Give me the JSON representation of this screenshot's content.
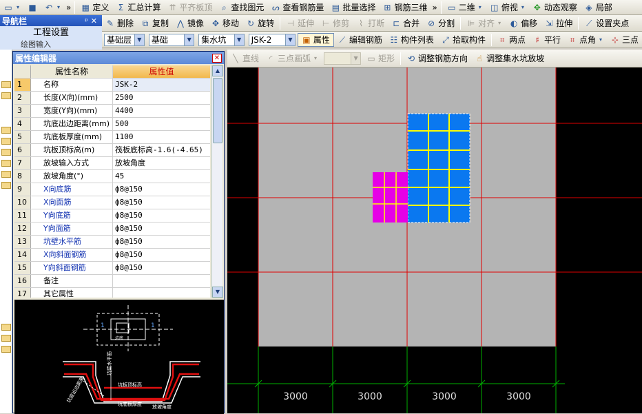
{
  "toolbar1": {
    "define": "定义",
    "sum_calc": "汇总计算",
    "align_slab": "平齐板顶",
    "find_element": "查找图元",
    "view_rebar_qty": "查看钢筋量",
    "batch_select": "批量选择",
    "rebar_3d": "钢筋三维",
    "view_mode": "二维",
    "top_view": "俯视",
    "dynamic_observe": "动态观察",
    "local": "局部"
  },
  "nav": {
    "title": "导航栏",
    "pin": "ᵖ",
    "close": "✕",
    "item": "工程设置",
    "sub": "绘图输入"
  },
  "toolbar2": {
    "delete": "删除",
    "copy": "复制",
    "mirror": "镜像",
    "move": "移动",
    "rotate": "旋转",
    "extend": "延伸",
    "trim": "修剪",
    "break": "打断",
    "merge": "合并",
    "split": "分割",
    "align": "对齐",
    "offset": "偏移",
    "stretch": "拉伸",
    "set_grip": "设置夹点"
  },
  "toolbar3": {
    "floor": "基础层",
    "type": "基础",
    "element": "集水坑",
    "instance": "JSK-2",
    "property": "属性",
    "edit_rebar": "编辑钢筋",
    "element_list": "构件列表",
    "pick_element": "拾取构件",
    "two_points": "两点",
    "parallel": "平行",
    "point_angle": "点角",
    "three_points": "三点"
  },
  "toolbar4": {
    "line": "直线",
    "three_arc": "三点画弧",
    "combo": "",
    "rect": "矩形",
    "adjust_rebar_dir": "调整钢筋方向",
    "adjust_pit_slope": "调整集水坑放坡"
  },
  "property_editor": {
    "title": "属性编辑器",
    "col_name": "属性名称",
    "col_value": "属性值",
    "rows": [
      {
        "n": "1",
        "k": "名称",
        "v": "JSK-2"
      },
      {
        "n": "2",
        "k": "长度(X向)(mm)",
        "v": "2500"
      },
      {
        "n": "3",
        "k": "宽度(Y向)(mm)",
        "v": "4400"
      },
      {
        "n": "4",
        "k": "坑底出边距离(mm)",
        "v": "500"
      },
      {
        "n": "5",
        "k": "坑底板厚度(mm)",
        "v": "1100"
      },
      {
        "n": "6",
        "k": "坑板顶标高(m)",
        "v": "筏板底标高-1.6(-4.65)"
      },
      {
        "n": "7",
        "k": "放坡输入方式",
        "v": "放坡角度"
      },
      {
        "n": "8",
        "k": "放坡角度(°)",
        "v": "45"
      },
      {
        "n": "9",
        "k": "X向底筋",
        "v": "ф8@150"
      },
      {
        "n": "10",
        "k": "X向面筋",
        "v": "ф8@150"
      },
      {
        "n": "11",
        "k": "Y向底筋",
        "v": "ф8@150"
      },
      {
        "n": "12",
        "k": "Y向面筋",
        "v": "ф8@150"
      },
      {
        "n": "13",
        "k": "坑壁水平筋",
        "v": "ф8@150"
      },
      {
        "n": "14",
        "k": "X向斜面钢筋",
        "v": "ф8@150"
      },
      {
        "n": "15",
        "k": "Y向斜面钢筋",
        "v": "ф8@150"
      },
      {
        "n": "16",
        "k": "备注",
        "v": ""
      },
      {
        "n": "17",
        "k": "其它属性",
        "v": ""
      }
    ]
  },
  "diagram": {
    "label_1a": "1",
    "label_1b": "1",
    "label_plan": "坑底",
    "label_wall": "坑壁水平筋",
    "label_top": "坑板顶标高",
    "label_thick": "坑底板厚度",
    "label_angle": "放坡角度",
    "label_slope": "坑底出边距离"
  },
  "canvas": {
    "dims": [
      "3000",
      "3000",
      "3000",
      "3000"
    ],
    "colors": {
      "slab": "#b4b4b4",
      "axis": "#e00000",
      "pit_blue": "#0a78f0",
      "pit_magenta": "#e600e6",
      "rebar": "#ffff00",
      "dim": "#00b000"
    }
  }
}
